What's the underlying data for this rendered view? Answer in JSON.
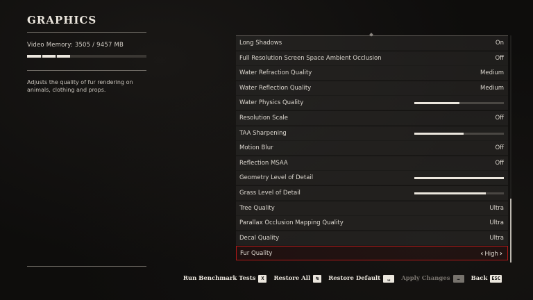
{
  "header": {
    "title": "GRAPHICS"
  },
  "video_memory": {
    "label": "Video Memory: 3505  /  9457  MB",
    "used_fraction": 0.37
  },
  "description": "Adjusts the quality of fur rendering on animals, clothing and props.",
  "settings": [
    {
      "label": "Long Shadows",
      "value": "On"
    },
    {
      "label": "Full Resolution Screen Space Ambient Occlusion",
      "value": "Off"
    },
    {
      "label": "Water Refraction Quality",
      "value": "Medium"
    },
    {
      "label": "Water Reflection Quality",
      "value": "Medium"
    },
    {
      "label": "Water Physics Quality",
      "slider": 0.5
    },
    {
      "label": "Resolution Scale",
      "value": "Off"
    },
    {
      "label": "TAA Sharpening",
      "slider": 0.55
    },
    {
      "label": "Motion Blur",
      "value": "Off"
    },
    {
      "label": "Reflection MSAA",
      "value": "Off"
    },
    {
      "label": "Geometry Level of Detail",
      "slider": 1.0
    },
    {
      "label": "Grass Level of Detail",
      "slider": 0.8
    },
    {
      "label": "Tree Quality",
      "value": "Ultra"
    },
    {
      "label": "Parallax Occlusion Mapping Quality",
      "value": "Ultra"
    },
    {
      "label": "Decal Quality",
      "value": "Ultra"
    },
    {
      "label": "Fur Quality",
      "value": "High",
      "selected": true
    }
  ],
  "scrollbar": {
    "position_fraction": 0.72,
    "visible_fraction": 0.28
  },
  "footer": {
    "run_benchmark": {
      "label": "Run Benchmark Tests",
      "key": "X"
    },
    "restore_all": {
      "label": "Restore All",
      "key": "↹"
    },
    "restore_default": {
      "label": "Restore Default",
      "key": "␣"
    },
    "apply_changes": {
      "label": "Apply Changes",
      "key": "…"
    },
    "back": {
      "label": "Back",
      "key": "ESC"
    }
  },
  "colors": {
    "selection_border": "#b01818",
    "text": "#dcd7cf",
    "background": "#0e0d0c"
  }
}
